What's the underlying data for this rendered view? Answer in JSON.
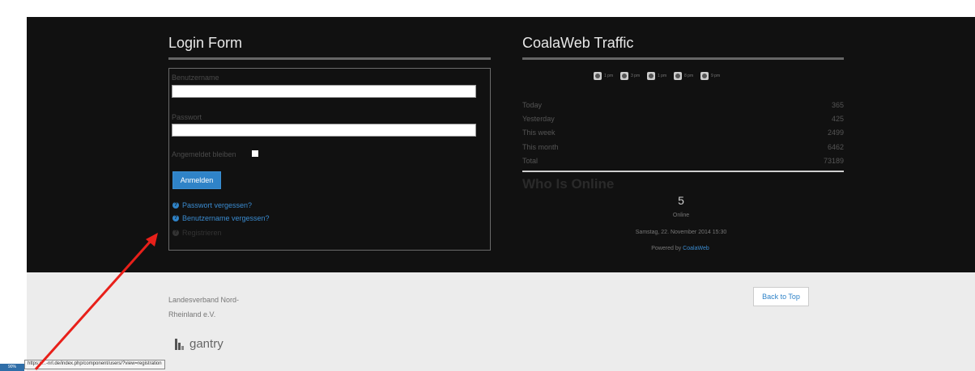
{
  "login": {
    "title": "Login Form",
    "username_label": "Benutzername",
    "username_value": "",
    "password_label": "Passwort",
    "password_value": "",
    "remember_label": "Angemeldet bleiben",
    "submit_label": "Anmelden",
    "links": [
      "Passwort vergessen?",
      "Benutzername vergessen?",
      "Registrieren"
    ]
  },
  "traffic": {
    "title": "CoalaWeb Traffic",
    "clocks": [
      "1 pm",
      "3 pm",
      "1 pm",
      "8 pm",
      "9 pm"
    ],
    "stats": [
      {
        "label": "Today",
        "value": "365"
      },
      {
        "label": "Yesterday",
        "value": "425"
      },
      {
        "label": "This week",
        "value": "2499"
      },
      {
        "label": "This month",
        "value": "6462"
      },
      {
        "label": "Total",
        "value": "73189"
      }
    ]
  },
  "who_online": {
    "title": "Who Is Online",
    "count": "5",
    "label": "Online",
    "date": "Samstag, 22. November 2014 15:30",
    "powered_prefix": "Powered by",
    "powered_link": "CoalaWeb"
  },
  "footer": {
    "org_line1": "Landesverband Nord-",
    "org_line2": "Rheinland e.V.",
    "back_to_top": "Back to Top",
    "logo_text": "gantry"
  },
  "status_bar": {
    "zoom": "90%",
    "url": "https://...-nrl.de/index.php/component/users/?view=registration"
  },
  "colors": {
    "accent": "#2f83c8",
    "dark_bg": "#111111",
    "footer_bg": "#ececec",
    "arrow": "#e8201a"
  }
}
